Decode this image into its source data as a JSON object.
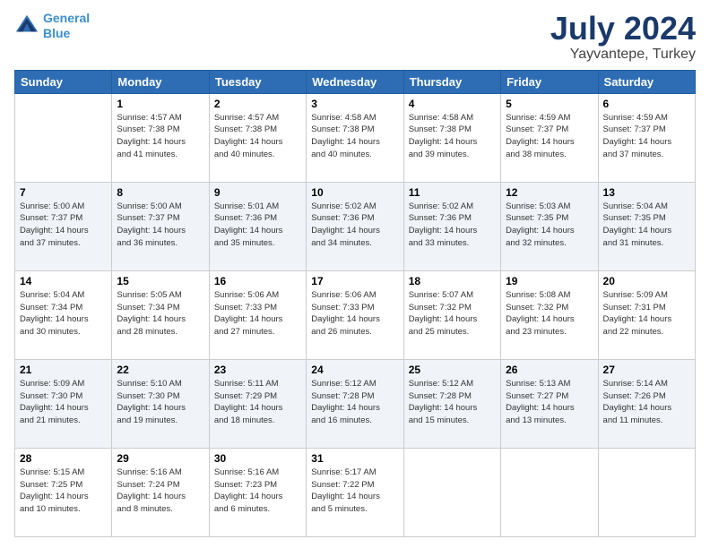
{
  "header": {
    "logo_line1": "General",
    "logo_line2": "Blue",
    "title": "July 2024",
    "subtitle": "Yayvantepe, Turkey"
  },
  "weekdays": [
    "Sunday",
    "Monday",
    "Tuesday",
    "Wednesday",
    "Thursday",
    "Friday",
    "Saturday"
  ],
  "weeks": [
    [
      {
        "day": "",
        "info": ""
      },
      {
        "day": "1",
        "info": "Sunrise: 4:57 AM\nSunset: 7:38 PM\nDaylight: 14 hours\nand 41 minutes."
      },
      {
        "day": "2",
        "info": "Sunrise: 4:57 AM\nSunset: 7:38 PM\nDaylight: 14 hours\nand 40 minutes."
      },
      {
        "day": "3",
        "info": "Sunrise: 4:58 AM\nSunset: 7:38 PM\nDaylight: 14 hours\nand 40 minutes."
      },
      {
        "day": "4",
        "info": "Sunrise: 4:58 AM\nSunset: 7:38 PM\nDaylight: 14 hours\nand 39 minutes."
      },
      {
        "day": "5",
        "info": "Sunrise: 4:59 AM\nSunset: 7:37 PM\nDaylight: 14 hours\nand 38 minutes."
      },
      {
        "day": "6",
        "info": "Sunrise: 4:59 AM\nSunset: 7:37 PM\nDaylight: 14 hours\nand 37 minutes."
      }
    ],
    [
      {
        "day": "7",
        "info": "Sunrise: 5:00 AM\nSunset: 7:37 PM\nDaylight: 14 hours\nand 37 minutes."
      },
      {
        "day": "8",
        "info": "Sunrise: 5:00 AM\nSunset: 7:37 PM\nDaylight: 14 hours\nand 36 minutes."
      },
      {
        "day": "9",
        "info": "Sunrise: 5:01 AM\nSunset: 7:36 PM\nDaylight: 14 hours\nand 35 minutes."
      },
      {
        "day": "10",
        "info": "Sunrise: 5:02 AM\nSunset: 7:36 PM\nDaylight: 14 hours\nand 34 minutes."
      },
      {
        "day": "11",
        "info": "Sunrise: 5:02 AM\nSunset: 7:36 PM\nDaylight: 14 hours\nand 33 minutes."
      },
      {
        "day": "12",
        "info": "Sunrise: 5:03 AM\nSunset: 7:35 PM\nDaylight: 14 hours\nand 32 minutes."
      },
      {
        "day": "13",
        "info": "Sunrise: 5:04 AM\nSunset: 7:35 PM\nDaylight: 14 hours\nand 31 minutes."
      }
    ],
    [
      {
        "day": "14",
        "info": "Sunrise: 5:04 AM\nSunset: 7:34 PM\nDaylight: 14 hours\nand 30 minutes."
      },
      {
        "day": "15",
        "info": "Sunrise: 5:05 AM\nSunset: 7:34 PM\nDaylight: 14 hours\nand 28 minutes."
      },
      {
        "day": "16",
        "info": "Sunrise: 5:06 AM\nSunset: 7:33 PM\nDaylight: 14 hours\nand 27 minutes."
      },
      {
        "day": "17",
        "info": "Sunrise: 5:06 AM\nSunset: 7:33 PM\nDaylight: 14 hours\nand 26 minutes."
      },
      {
        "day": "18",
        "info": "Sunrise: 5:07 AM\nSunset: 7:32 PM\nDaylight: 14 hours\nand 25 minutes."
      },
      {
        "day": "19",
        "info": "Sunrise: 5:08 AM\nSunset: 7:32 PM\nDaylight: 14 hours\nand 23 minutes."
      },
      {
        "day": "20",
        "info": "Sunrise: 5:09 AM\nSunset: 7:31 PM\nDaylight: 14 hours\nand 22 minutes."
      }
    ],
    [
      {
        "day": "21",
        "info": "Sunrise: 5:09 AM\nSunset: 7:30 PM\nDaylight: 14 hours\nand 21 minutes."
      },
      {
        "day": "22",
        "info": "Sunrise: 5:10 AM\nSunset: 7:30 PM\nDaylight: 14 hours\nand 19 minutes."
      },
      {
        "day": "23",
        "info": "Sunrise: 5:11 AM\nSunset: 7:29 PM\nDaylight: 14 hours\nand 18 minutes."
      },
      {
        "day": "24",
        "info": "Sunrise: 5:12 AM\nSunset: 7:28 PM\nDaylight: 14 hours\nand 16 minutes."
      },
      {
        "day": "25",
        "info": "Sunrise: 5:12 AM\nSunset: 7:28 PM\nDaylight: 14 hours\nand 15 minutes."
      },
      {
        "day": "26",
        "info": "Sunrise: 5:13 AM\nSunset: 7:27 PM\nDaylight: 14 hours\nand 13 minutes."
      },
      {
        "day": "27",
        "info": "Sunrise: 5:14 AM\nSunset: 7:26 PM\nDaylight: 14 hours\nand 11 minutes."
      }
    ],
    [
      {
        "day": "28",
        "info": "Sunrise: 5:15 AM\nSunset: 7:25 PM\nDaylight: 14 hours\nand 10 minutes."
      },
      {
        "day": "29",
        "info": "Sunrise: 5:16 AM\nSunset: 7:24 PM\nDaylight: 14 hours\nand 8 minutes."
      },
      {
        "day": "30",
        "info": "Sunrise: 5:16 AM\nSunset: 7:23 PM\nDaylight: 14 hours\nand 6 minutes."
      },
      {
        "day": "31",
        "info": "Sunrise: 5:17 AM\nSunset: 7:22 PM\nDaylight: 14 hours\nand 5 minutes."
      },
      {
        "day": "",
        "info": ""
      },
      {
        "day": "",
        "info": ""
      },
      {
        "day": "",
        "info": ""
      }
    ]
  ]
}
